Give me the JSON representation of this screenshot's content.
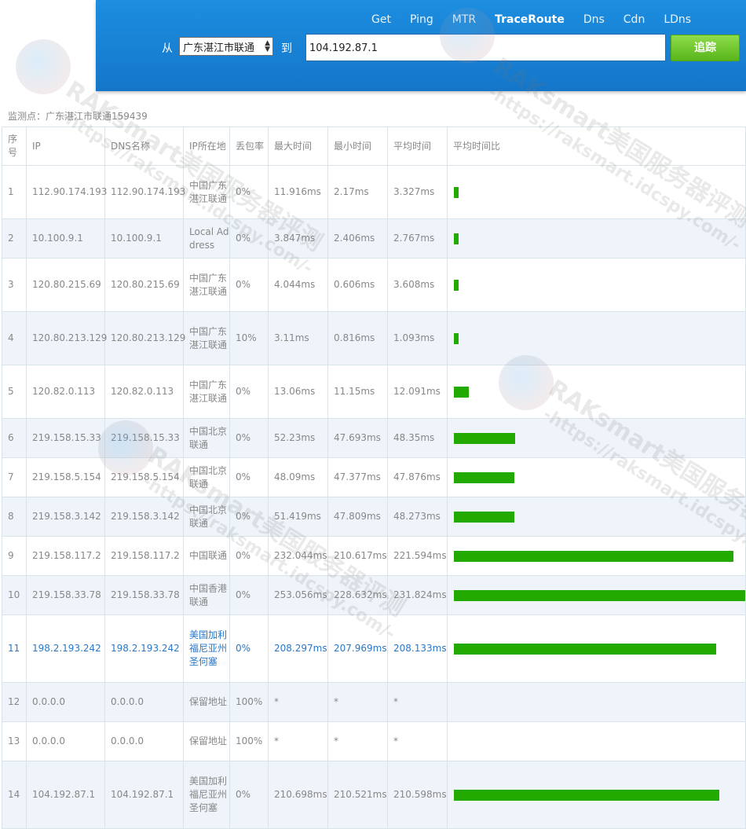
{
  "header": {
    "nav": [
      {
        "label": "Get",
        "active": false
      },
      {
        "label": "Ping",
        "active": false
      },
      {
        "label": "MTR",
        "active": false
      },
      {
        "label": "TraceRoute",
        "active": true
      },
      {
        "label": "Dns",
        "active": false
      },
      {
        "label": "Cdn",
        "active": false
      },
      {
        "label": "LDns",
        "active": false
      }
    ],
    "from_label": "从",
    "source_value": "广东湛江市联通",
    "to_label": "到",
    "target_value": "104.192.87.1",
    "trace_button": "追踪"
  },
  "monitor_label": "监测点：广东湛江市联通159439",
  "table": {
    "headers": [
      "序号",
      "IP",
      "DNS名称",
      "IP所在地",
      "丢包率",
      "最大时间",
      "最小时间",
      "平均时间",
      "平均时间比"
    ],
    "rows": [
      {
        "no": "1",
        "ip": "112.90.174.193",
        "dns": "112.90.174.193",
        "loc": "中国广东湛江联通",
        "loss": "0%",
        "max": "11.916ms",
        "min": "2.17ms",
        "avg": "3.327ms",
        "ratio": 0.0144
      },
      {
        "no": "2",
        "ip": "10.100.9.1",
        "dns": "10.100.9.1",
        "loc": "Local Address",
        "loss": "0%",
        "max": "3.847ms",
        "min": "2.406ms",
        "avg": "2.767ms",
        "ratio": 0.0119
      },
      {
        "no": "3",
        "ip": "120.80.215.69",
        "dns": "120.80.215.69",
        "loc": "中国广东湛江联通",
        "loss": "0%",
        "max": "4.044ms",
        "min": "0.606ms",
        "avg": "3.608ms",
        "ratio": 0.0156
      },
      {
        "no": "4",
        "ip": "120.80.213.129",
        "dns": "120.80.213.129",
        "loc": "中国广东湛江联通",
        "loss": "10%",
        "max": "3.11ms",
        "min": "0.816ms",
        "avg": "1.093ms",
        "ratio": 0.0047
      },
      {
        "no": "5",
        "ip": "120.82.0.113",
        "dns": "120.82.0.113",
        "loc": "中国广东湛江联通",
        "loss": "0%",
        "max": "13.06ms",
        "min": "11.15ms",
        "avg": "12.091ms",
        "ratio": 0.0522
      },
      {
        "no": "6",
        "ip": "219.158.15.33",
        "dns": "219.158.15.33",
        "loc": "中国北京联通",
        "loss": "0%",
        "max": "52.23ms",
        "min": "47.693ms",
        "avg": "48.35ms",
        "ratio": 0.2086
      },
      {
        "no": "7",
        "ip": "219.158.5.154",
        "dns": "219.158.5.154",
        "loc": "中国北京联通",
        "loss": "0%",
        "max": "48.09ms",
        "min": "47.377ms",
        "avg": "47.876ms",
        "ratio": 0.2065
      },
      {
        "no": "8",
        "ip": "219.158.3.142",
        "dns": "219.158.3.142",
        "loc": "中国北京联通",
        "loss": "0%",
        "max": "51.419ms",
        "min": "47.809ms",
        "avg": "48.273ms",
        "ratio": 0.2082
      },
      {
        "no": "9",
        "ip": "219.158.117.2",
        "dns": "219.158.117.2",
        "loc": "中国联通",
        "loss": "0%",
        "max": "232.044ms",
        "min": "210.617ms",
        "avg": "221.594ms",
        "ratio": 0.9559
      },
      {
        "no": "10",
        "ip": "219.158.33.78",
        "dns": "219.158.33.78",
        "loc": "中国香港联通",
        "loss": "0%",
        "max": "253.056ms",
        "min": "228.632ms",
        "avg": "231.824ms",
        "ratio": 1.0
      },
      {
        "no": "11",
        "ip": "198.2.193.242",
        "dns": "198.2.193.242",
        "loc": "美国加利福尼亚州圣何塞",
        "loss": "0%",
        "max": "208.297ms",
        "min": "207.969ms",
        "avg": "208.133ms",
        "ratio": 0.8978,
        "highlight": true
      },
      {
        "no": "12",
        "ip": "0.0.0.0",
        "dns": "0.0.0.0",
        "loc": "保留地址",
        "loss": "100%",
        "max": "*",
        "min": "*",
        "avg": "*",
        "ratio": 0
      },
      {
        "no": "13",
        "ip": "0.0.0.0",
        "dns": "0.0.0.0",
        "loc": "保留地址",
        "loss": "100%",
        "max": "*",
        "min": "*",
        "avg": "*",
        "ratio": 0
      },
      {
        "no": "14",
        "ip": "104.192.87.1",
        "dns": "104.192.87.1",
        "loc": "美国加利福尼亚州圣何塞",
        "loss": "0%",
        "max": "210.698ms",
        "min": "210.521ms",
        "avg": "210.598ms",
        "ratio": 0.9084
      }
    ]
  },
  "watermark": {
    "brand": "RAKsmart美国服务器评测",
    "url": "-https://raksmart.idcspy.com/-"
  },
  "colors": {
    "header_blue": "#1a84d6",
    "bar_green": "#22aa00",
    "link_blue": "#2a78c8"
  }
}
